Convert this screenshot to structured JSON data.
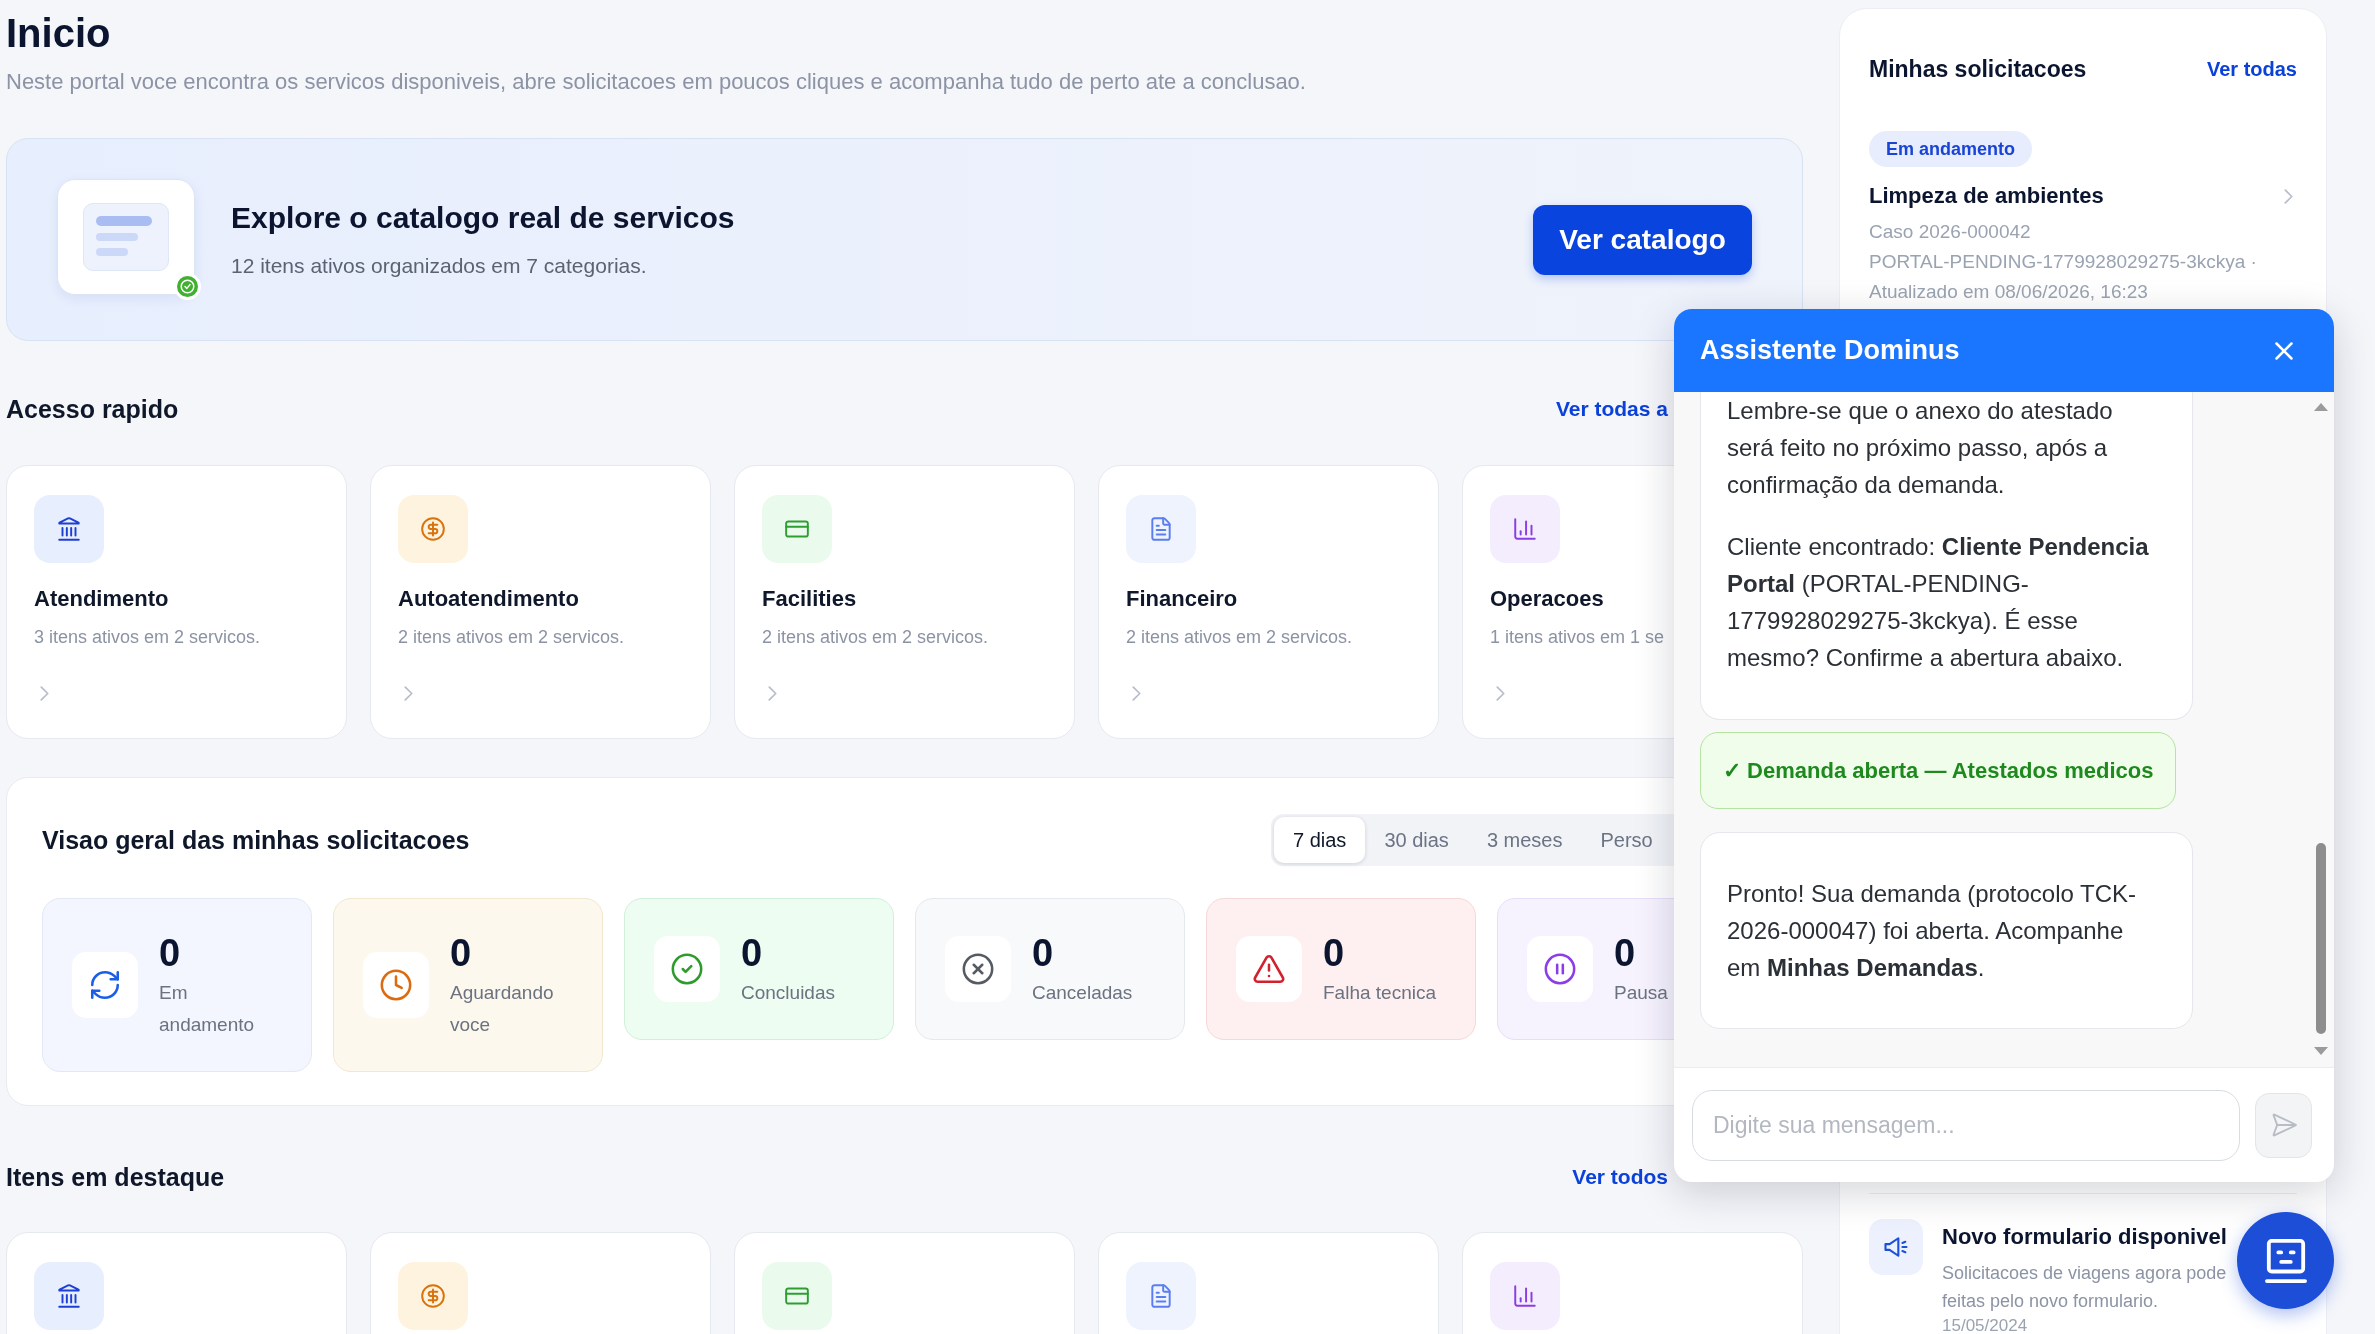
{
  "page": {
    "title": "Inicio",
    "subtitle": "Neste portal voce encontra os servicos disponiveis, abre solicitacoes em poucos cliques e acompanha tudo de perto ate a conclusao."
  },
  "banner": {
    "title": "Explore o catalogo real de servicos",
    "subtitle": "12 itens ativos organizados em 7 categorias.",
    "button": "Ver catalogo"
  },
  "quick_access": {
    "title": "Acesso rapido",
    "link": "Ver todas a",
    "items": [
      {
        "kind": "attendance",
        "name": "Atendimento",
        "description": "3 itens ativos em 2 servicos."
      },
      {
        "kind": "selfservice",
        "name": "Autoatendimento",
        "description": "2 itens ativos em 2 servicos."
      },
      {
        "kind": "facilities",
        "name": "Facilities",
        "description": "2 itens ativos em 2 servicos."
      },
      {
        "kind": "finance",
        "name": "Financeiro",
        "description": "2 itens ativos em 2 servicos."
      },
      {
        "kind": "operations",
        "name": "Operacoes",
        "description": "1 itens ativos em 1 se"
      }
    ]
  },
  "overview": {
    "title": "Visao geral das minhas solicitacoes",
    "periods": [
      {
        "label": "7 dias",
        "selected": true
      },
      {
        "label": "30 dias",
        "selected": false
      },
      {
        "label": "3 meses",
        "selected": false
      },
      {
        "label": "Perso",
        "selected": false
      }
    ],
    "stats": [
      {
        "kind": "progress",
        "count": "0",
        "label": "Em andamento"
      },
      {
        "kind": "waiting",
        "count": "0",
        "label": "Aguardando voce"
      },
      {
        "kind": "completed",
        "count": "0",
        "label": "Concluidas"
      },
      {
        "kind": "cancelled",
        "count": "0",
        "label": "Canceladas"
      },
      {
        "kind": "failure",
        "count": "0",
        "label": "Falha tecnica"
      },
      {
        "kind": "paused",
        "count": "0",
        "label": "Pausa"
      }
    ]
  },
  "featured": {
    "title": "Itens em destaque",
    "link": "Ver todos",
    "items": [
      {
        "kind": "attendance"
      },
      {
        "kind": "selfservice"
      },
      {
        "kind": "facilities"
      },
      {
        "kind": "finance"
      },
      {
        "kind": "operations"
      }
    ]
  },
  "requests_panel": {
    "title": "Minhas solicitacoes",
    "link": "Ver todas",
    "items": [
      {
        "status": "Em andamento",
        "title": "Limpeza de ambientes",
        "case": "Caso 2026-000042",
        "meta": "PORTAL-PENDING-1779928029275-3kckya · Atualizado em 08/06/2026, 16:23"
      }
    ],
    "notice": {
      "title": "Novo formulario disponivel",
      "lines": [
        "Solicitacoes de viagens agora pode",
        "feitas pelo novo formulario."
      ],
      "date": "15/05/2024"
    }
  },
  "chat": {
    "title": "Assistente Dominus",
    "messages": [
      {
        "kind": "bot",
        "paragraphs": [
          "Lembre-se que o anexo do atestado será feito no próximo passo, após a confirmação da demanda.",
          "Cliente encontrado: **Cliente Pendencia Portal** (PORTAL-PENDING-1779928029275-3kckya). É esse mesmo? Confirme a abertura abaixo."
        ]
      },
      {
        "kind": "status",
        "text": "✓ Demanda aberta — Atestados medicos"
      },
      {
        "kind": "bot",
        "paragraphs": [
          "Pronto! Sua demanda (protocolo TCK-2026-000047) foi aberta. Acompanhe em **Minhas Demandas**."
        ]
      }
    ],
    "input": {
      "placeholder": "Digite sua mensagem..."
    }
  }
}
